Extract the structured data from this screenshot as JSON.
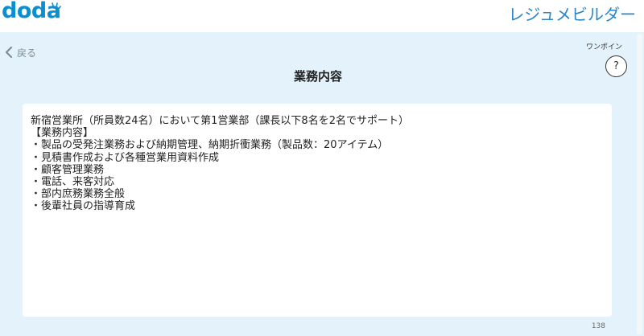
{
  "header": {
    "logo_text": "doda",
    "brand_title": "レジュメビルダー"
  },
  "nav": {
    "back_label": "戻る"
  },
  "onepoint": {
    "label": "ワンポイン",
    "help_glyph": "?"
  },
  "page": {
    "title": "業務内容"
  },
  "editor": {
    "value": "新宿営業所（所員数24名）において第1営業部（課長以下8名を2名でサポート）\n【業務内容】\n・製品の受発注業務および納期管理、納期折衝業務（製品数：20アイテム）\n・見積書作成および各種営業用資料作成\n・顧客管理業務\n・電話、来客対応\n・部内庶務業務全般\n・後輩社員の指導育成",
    "char_count": "138"
  },
  "colors": {
    "brand_blue": "#0a8fd0",
    "title_blue": "#2b86c5",
    "panel_bg": "#e4f2fb"
  }
}
